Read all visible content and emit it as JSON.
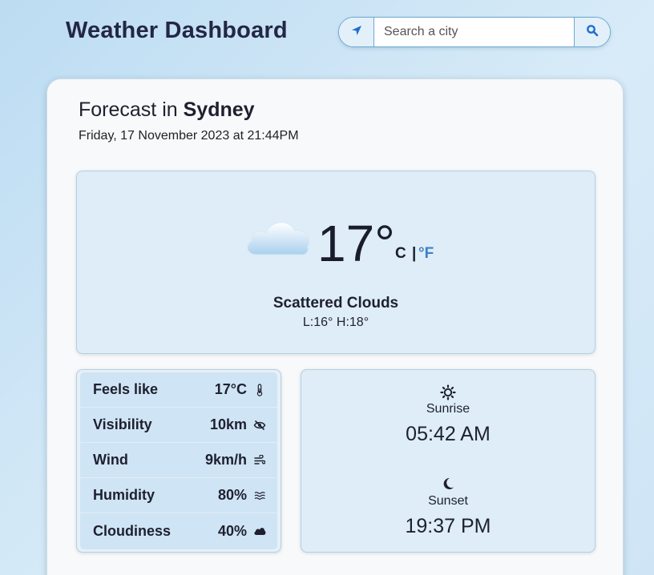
{
  "header": {
    "title": "Weather Dashboard",
    "search": {
      "placeholder": "Search a city",
      "value": ""
    },
    "icons": {
      "locate": "location-arrow-icon",
      "search": "search-icon"
    }
  },
  "forecast": {
    "heading_prefix": "Forecast in",
    "city": "Sydney",
    "datetime": "Friday, 17 November 2023 at 21:44PM"
  },
  "current": {
    "icon": "cloud-icon",
    "temperature": "17°",
    "unit_c": "C",
    "unit_separator": "|",
    "unit_f": "°F",
    "condition": "Scattered Clouds",
    "low_high": "L:16° H:18°"
  },
  "details": [
    {
      "label": "Feels like",
      "value": "17°C",
      "icon": "thermometer-icon"
    },
    {
      "label": "Visibility",
      "value": "10km",
      "icon": "eye-slash-icon"
    },
    {
      "label": "Wind",
      "value": "9km/h",
      "icon": "wind-icon"
    },
    {
      "label": "Humidity",
      "value": "80%",
      "icon": "water-icon"
    },
    {
      "label": "Cloudiness",
      "value": "40%",
      "icon": "cloud-icon"
    }
  ],
  "sun": {
    "sunrise": {
      "label": "Sunrise",
      "time": "05:42 AM",
      "icon": "sun-icon"
    },
    "sunset": {
      "label": "Sunset",
      "time": "19:37 PM",
      "icon": "moon-icon"
    }
  },
  "colors": {
    "accent": "#3d7fc4",
    "text": "#1e2030",
    "panel": "#deedf8"
  }
}
